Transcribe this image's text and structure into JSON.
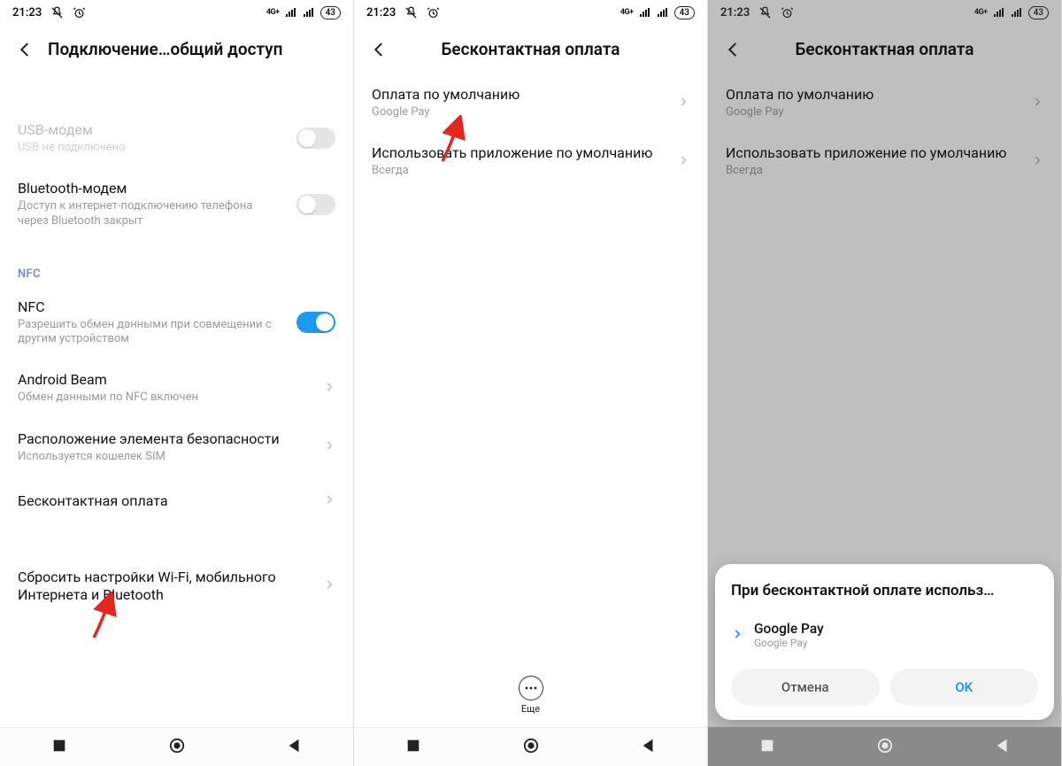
{
  "status": {
    "time": "21:23",
    "net": "4G+",
    "battery": "43"
  },
  "s1": {
    "title": "Подключение…общий доступ",
    "usb": {
      "title": "USB-модем",
      "sub": "USB не подключено"
    },
    "bt": {
      "title": "Bluetooth-модем",
      "sub": "Доступ к интернет-подключению телефона через Bluetooth закрыт"
    },
    "section_nfc": "NFC",
    "nfc": {
      "title": "NFC",
      "sub": "Разрешить обмен данными при совмещении с другим устройством"
    },
    "beam": {
      "title": "Android Beam",
      "sub": "Обмен данными по NFC включен"
    },
    "secure": {
      "title": "Расположение элемента безопасности",
      "sub": "Используется кошелек SIM"
    },
    "contactless": {
      "title": "Бесконтактная оплата"
    },
    "reset": {
      "title": "Сбросить настройки Wi-Fi, мобильного Интернета и Bluetooth"
    }
  },
  "s2": {
    "title": "Бесконтактная оплата",
    "default_pay": {
      "title": "Оплата по умолчанию",
      "sub": "Google Pay"
    },
    "use_app": {
      "title": "Использовать приложение по умолчанию",
      "sub": "Всегда"
    },
    "more": "Еще"
  },
  "s3": {
    "title": "Бесконтактная оплата",
    "default_pay": {
      "title": "Оплата по умолчанию",
      "sub": "Google Pay"
    },
    "use_app": {
      "title": "Использовать приложение по умолчанию",
      "sub": "Всегда"
    },
    "sheet": {
      "title": "При бесконтактной оплате использ…",
      "option": {
        "title": "Google Pay",
        "sub": "Google Pay"
      },
      "cancel": "Отмена",
      "ok": "OK"
    }
  }
}
